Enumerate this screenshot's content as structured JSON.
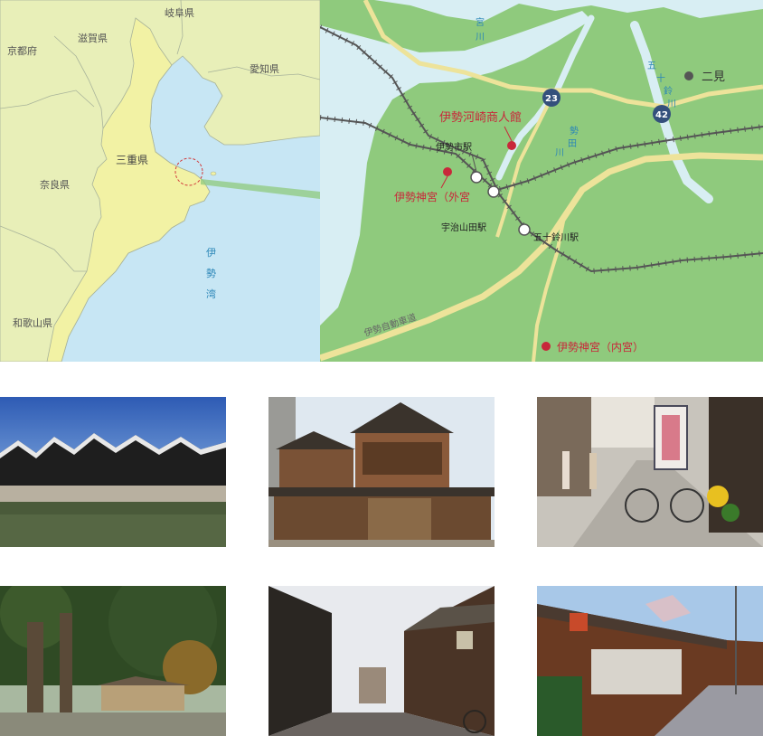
{
  "regional_map": {
    "prefectures": [
      "岐阜県",
      "京都府",
      "滋賀県",
      "愛知県",
      "三重県",
      "奈良県",
      "和歌山県"
    ],
    "bay_label_chars": [
      "伊",
      "勢",
      "湾"
    ]
  },
  "detail_map": {
    "rivers": {
      "miya_chars": [
        "宮",
        "川"
      ],
      "seta_chars": [
        "勢",
        "田",
        "川"
      ],
      "isuzu_chars": [
        "五",
        "十",
        "鈴",
        "川"
      ]
    },
    "route_badges": [
      "23",
      "42"
    ],
    "expressway": "伊勢自動車道",
    "places": {
      "futami": "二見",
      "museum": "伊勢河崎商人館",
      "ise_station": "伊勢市駅",
      "geku": "伊勢神宮（外宮",
      "ujiyamada": "宇治山田駅",
      "isuzugawa": "五十鈴川駅",
      "naiku": "伊勢神宮（内宮）"
    },
    "colors": {
      "land": "#8fca7d",
      "river": "#d8eef3",
      "road": "#ede39a",
      "poi": "#c8283a",
      "badge": "#34507c"
    }
  },
  "photos": [
    {
      "subject": "canal-warehouses"
    },
    {
      "subject": "merchant-house-facade"
    },
    {
      "subject": "street-rickshaw"
    },
    {
      "subject": "shrine-grove"
    },
    {
      "subject": "warehouse-alley"
    },
    {
      "subject": "old-shop-row"
    }
  ]
}
